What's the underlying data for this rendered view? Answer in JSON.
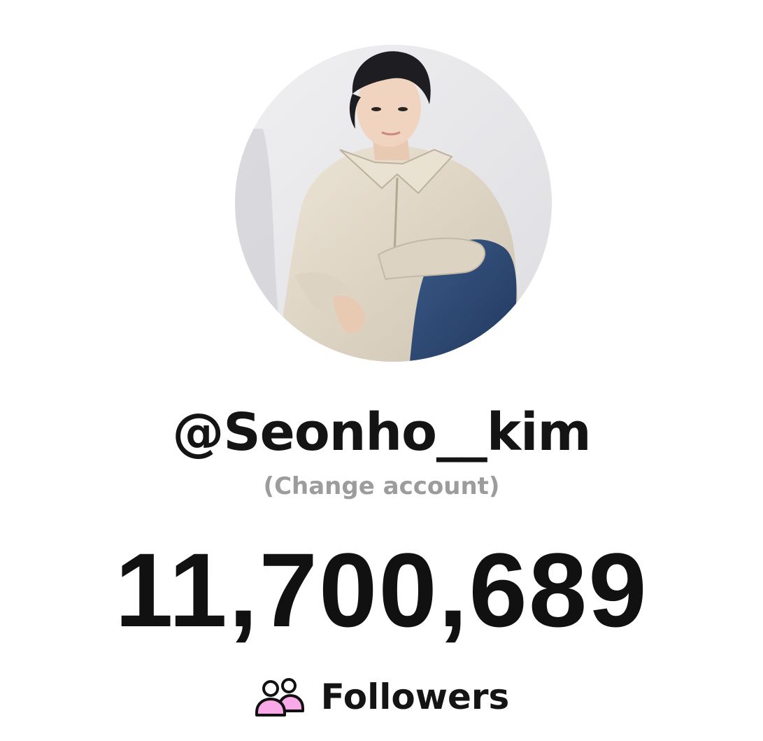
{
  "profile": {
    "username": "@Seonho__kim",
    "change_account_label": "(Change account)",
    "avatar_alt": "profile photo"
  },
  "stats": {
    "followers_count": "11,700,689",
    "followers_label": "Followers",
    "followers_icon": "users-icon"
  },
  "colors": {
    "background": "#ffffff",
    "text_primary": "#141414",
    "text_secondary": "#9c9c9c",
    "icon_accent": "#f9a8e8",
    "icon_outline": "#111111"
  }
}
